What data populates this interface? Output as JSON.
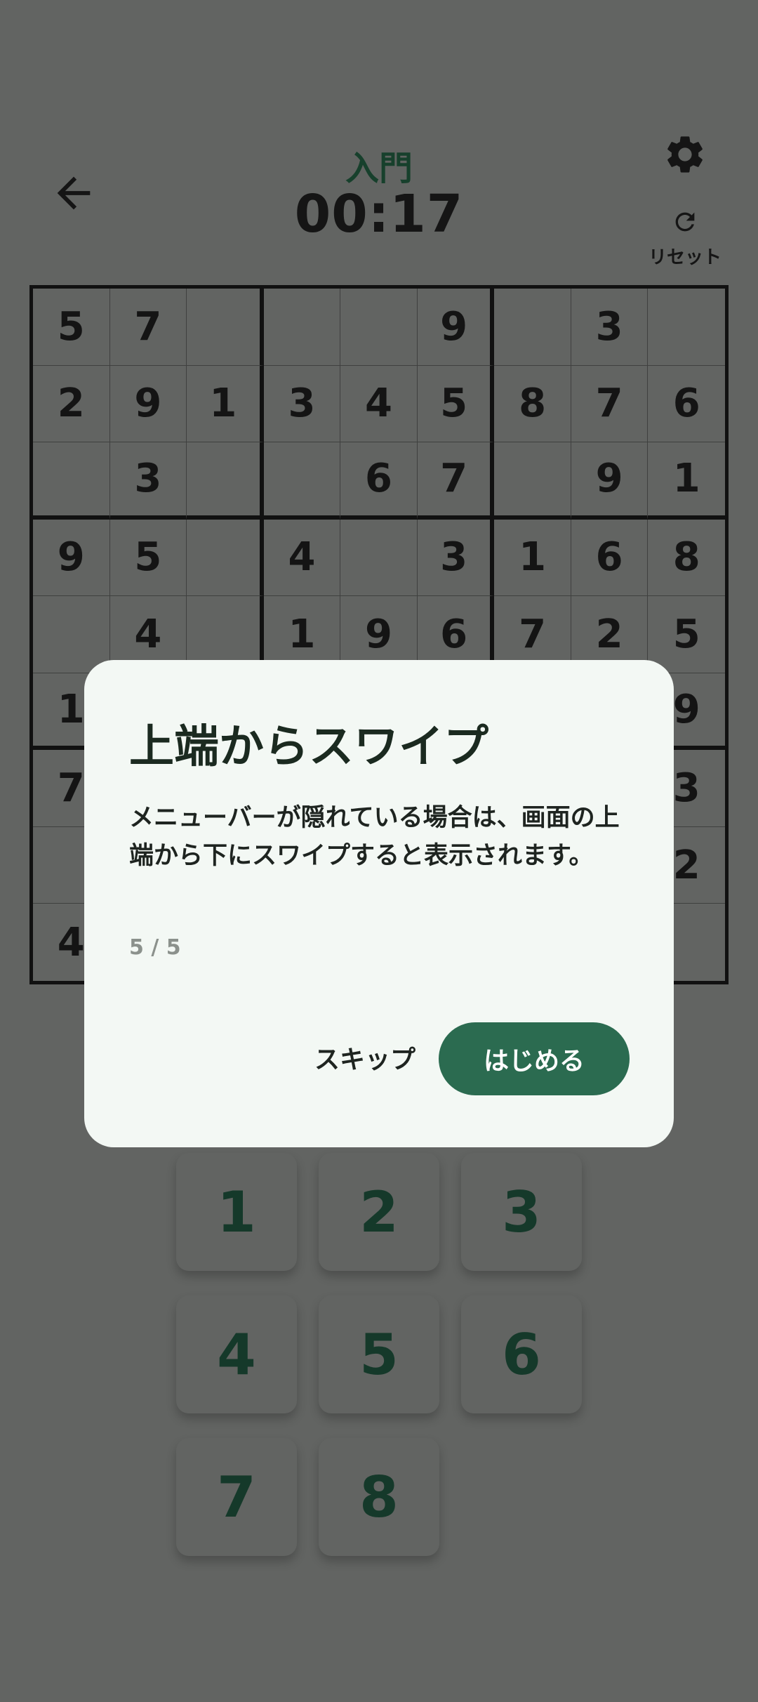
{
  "header": {
    "difficulty": "入門",
    "timer": "00:17",
    "reset_label": "リセット",
    "icons": {
      "back": "arrow-left-icon",
      "settings": "gear-icon",
      "reset": "refresh-icon"
    }
  },
  "board": [
    [
      "5",
      "7",
      "",
      "",
      "",
      "9",
      "",
      "3",
      ""
    ],
    [
      "2",
      "9",
      "1",
      "3",
      "4",
      "5",
      "8",
      "7",
      "6"
    ],
    [
      "",
      "3",
      "",
      "",
      "6",
      "7",
      "",
      "9",
      "1"
    ],
    [
      "9",
      "5",
      "",
      "4",
      "",
      "3",
      "1",
      "6",
      "8"
    ],
    [
      "",
      "4",
      "",
      "1",
      "9",
      "6",
      "7",
      "2",
      "5"
    ],
    [
      "1",
      "",
      "",
      "",
      "",
      "",
      "",
      "",
      "9"
    ],
    [
      "7",
      "",
      "",
      "",
      "",
      "",
      "",
      "",
      "3"
    ],
    [
      "",
      "",
      "",
      "",
      "",
      "",
      "",
      "",
      "2"
    ],
    [
      "4",
      "",
      "",
      "",
      "",
      "",
      "",
      "",
      ""
    ]
  ],
  "keypad": [
    "1",
    "2",
    "3",
    "4",
    "5",
    "6",
    "7",
    "8"
  ],
  "dialog": {
    "title": "上端からスワイプ",
    "body": "メニューバーが隠れている場合は、画面の上端から下にスワイプすると表示されます。",
    "page_indicator": "5 / 5",
    "skip_label": "スキップ",
    "start_label": "はじめる"
  },
  "colors": {
    "background_dim": "#626462",
    "accent": "#2b6b50",
    "dialog_bg": "#f3f8f4",
    "difficulty_text": "#17402c"
  }
}
